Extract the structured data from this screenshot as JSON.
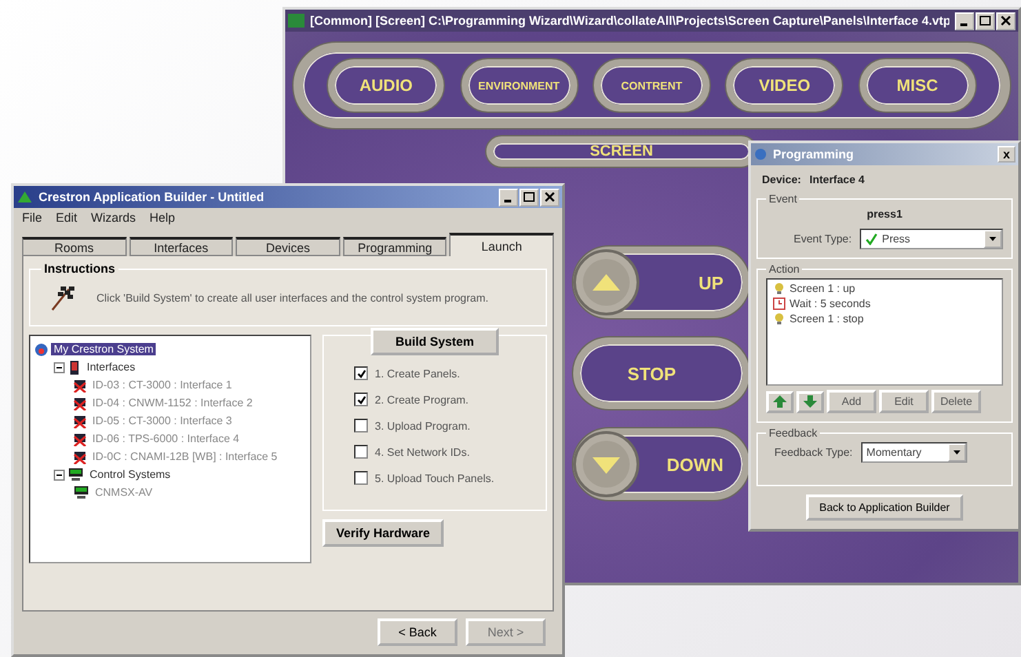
{
  "panel_window": {
    "title": "[Common] [Screen] C:\\Programming Wizard\\Wizard\\collateAll\\Projects\\Screen Capture\\Panels\\Interface 4.vtp",
    "top_buttons": [
      "AUDIO",
      "ENVIRONMENT",
      "CONTRENT",
      "VIDEO",
      "MISC"
    ],
    "screen_button": "SCREEN",
    "side_buttons": [
      {
        "label": "UP",
        "kind": "up"
      },
      {
        "label": "STOP",
        "kind": "plain"
      },
      {
        "label": "DOWN",
        "kind": "down"
      }
    ]
  },
  "builder_window": {
    "title": "Crestron Application Builder - Untitled",
    "menu": [
      "File",
      "Edit",
      "Wizards",
      "Help"
    ],
    "tabs": [
      {
        "label": "Rooms",
        "selected": false
      },
      {
        "label": "Interfaces",
        "selected": false
      },
      {
        "label": "Devices",
        "selected": false
      },
      {
        "label": "Programming",
        "selected": false
      },
      {
        "label": "Launch",
        "selected": true
      }
    ],
    "instructions": {
      "heading": "Instructions",
      "text": "Click 'Build System' to create all user interfaces and the control system program."
    },
    "tree": [
      {
        "label": "My Crestron System",
        "kind": "system",
        "selected": true,
        "children": [
          {
            "label": "Interfaces",
            "kind": "folder",
            "selected": false,
            "expanded": true,
            "children": [
              {
                "label": "ID-03 : CT-3000 : Interface 1",
                "kind": "panel",
                "selected": false
              },
              {
                "label": "ID-04 : CNWM-1152 : Interface 2",
                "kind": "panel",
                "selected": false
              },
              {
                "label": "ID-05 : CT-3000 : Interface 3",
                "kind": "panel",
                "selected": false
              },
              {
                "label": "ID-06 : TPS-6000 : Interface 4",
                "kind": "panel",
                "selected": false
              },
              {
                "label": "ID-0C : CNAMI-12B [WB] : Interface 5",
                "kind": "panel",
                "selected": false
              }
            ]
          },
          {
            "label": "Control Systems",
            "kind": "controller",
            "selected": false,
            "expanded": true,
            "children": [
              {
                "label": "CNMSX-AV",
                "kind": "controller",
                "selected": false
              }
            ]
          }
        ]
      }
    ],
    "build_button": "Build System",
    "steps": [
      {
        "label": "1. Create Panels.",
        "checked": true
      },
      {
        "label": "2. Create Program.",
        "checked": true
      },
      {
        "label": "3. Upload Program.",
        "checked": false
      },
      {
        "label": "4. Set Network IDs.",
        "checked": false
      },
      {
        "label": "5. Upload Touch Panels.",
        "checked": false
      }
    ],
    "verify_button": "Verify Hardware",
    "nav_buttons": [
      {
        "label": "< Back",
        "disabled": false
      },
      {
        "label": "Next >",
        "disabled": true
      }
    ]
  },
  "programming_dialog": {
    "title": "Programming",
    "close": "x",
    "device_label": "Device:",
    "device": "Interface 4",
    "event_heading": "Event",
    "event_name": "press1",
    "event_type_label": "Event Type:",
    "event_type": "Press",
    "action_heading": "Action",
    "actions": [
      {
        "label": "Screen 1 : up",
        "kind": "panel"
      },
      {
        "label": "Wait : 5 seconds",
        "kind": "wait"
      },
      {
        "label": "Screen 1 : stop",
        "kind": "panel"
      }
    ],
    "action_buttons": [
      "Add",
      "Edit",
      "Delete"
    ],
    "feedback_heading": "Feedback",
    "feedback_type_label": "Feedback Type:",
    "feedback_type": "Momentary",
    "back_button": "Back to Application Builder"
  }
}
